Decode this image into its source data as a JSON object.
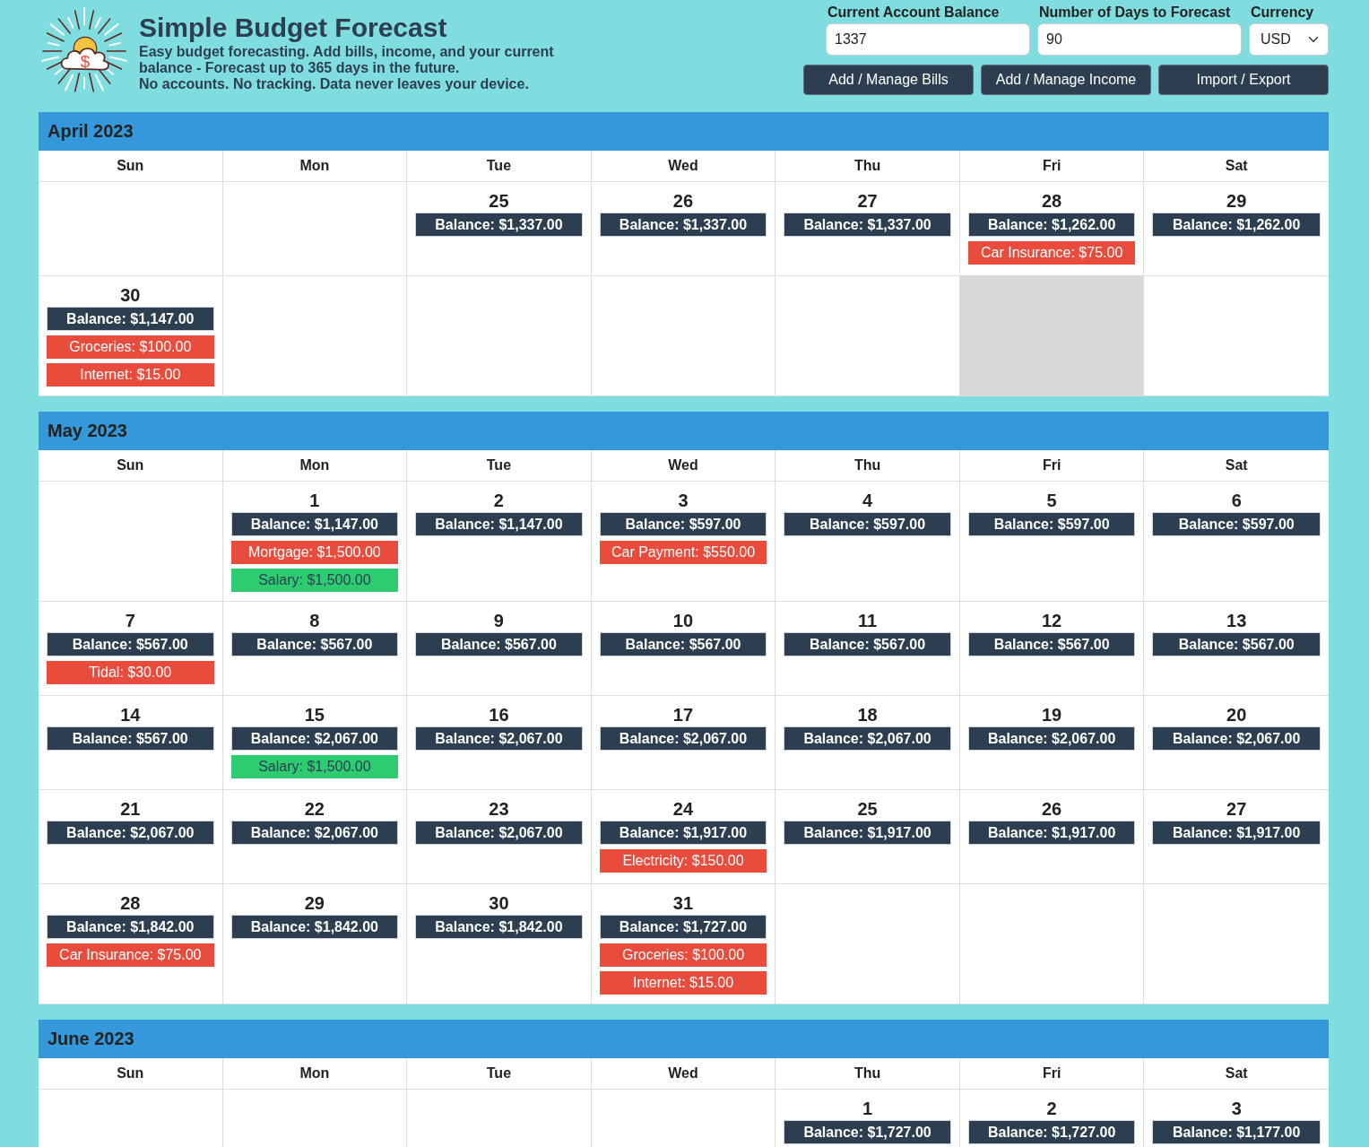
{
  "header": {
    "logo_symbol": "$",
    "title": "Simple Budget Forecast",
    "description": "Easy budget forecasting. Add bills, income, and your current balance - Forecast up to 365 days in the future.",
    "privacy_note": "No accounts. No tracking. Data never leaves your device."
  },
  "controls": {
    "fields": [
      {
        "kind": "text",
        "label": "Current Account Balance",
        "value": "1337"
      },
      {
        "kind": "text",
        "label": "Number of Days to Forecast",
        "value": "90"
      },
      {
        "kind": "select",
        "label": "Currency",
        "value": "USD"
      }
    ],
    "buttons": [
      "Add / Manage Bills",
      "Add / Manage Income",
      "Import / Export"
    ]
  },
  "months": [
    {
      "title": "April 2023",
      "weekdays": [
        "Sun",
        "Mon",
        "Tue",
        "Wed",
        "Thu",
        "Fri",
        "Sat"
      ],
      "weeks": [
        [
          {
            "highlighted": false
          },
          {
            "highlighted": false
          },
          {
            "day": "25",
            "balance": "Balance: $1,337.00",
            "highlighted": false
          },
          {
            "day": "26",
            "balance": "Balance: $1,337.00",
            "highlighted": false
          },
          {
            "day": "27",
            "balance": "Balance: $1,337.00",
            "highlighted": false
          },
          {
            "day": "28",
            "balance": "Balance: $1,262.00",
            "entries": [
              {
                "kind": "bill",
                "text": "Car Insurance: $75.00"
              }
            ],
            "highlighted": false
          },
          {
            "day": "29",
            "balance": "Balance: $1,262.00",
            "highlighted": false
          }
        ],
        [
          {
            "day": "30",
            "balance": "Balance: $1,147.00",
            "entries": [
              {
                "kind": "bill",
                "text": "Groceries: $100.00"
              },
              {
                "kind": "bill",
                "text": "Internet: $15.00"
              }
            ],
            "highlighted": false
          },
          {
            "highlighted": false
          },
          {
            "highlighted": false
          },
          {
            "highlighted": false
          },
          {
            "highlighted": false
          },
          {
            "highlighted": true
          },
          {
            "highlighted": false
          }
        ]
      ]
    },
    {
      "title": "May 2023",
      "weekdays": [
        "Sun",
        "Mon",
        "Tue",
        "Wed",
        "Thu",
        "Fri",
        "Sat"
      ],
      "weeks": [
        [
          {
            "highlighted": false
          },
          {
            "day": "1",
            "balance": "Balance: $1,147.00",
            "entries": [
              {
                "kind": "bill",
                "text": "Mortgage: $1,500.00"
              },
              {
                "kind": "income",
                "text": "Salary: $1,500.00"
              }
            ],
            "highlighted": false
          },
          {
            "day": "2",
            "balance": "Balance: $1,147.00",
            "highlighted": false
          },
          {
            "day": "3",
            "balance": "Balance: $597.00",
            "entries": [
              {
                "kind": "bill",
                "text": "Car Payment: $550.00"
              }
            ],
            "highlighted": false
          },
          {
            "day": "4",
            "balance": "Balance: $597.00",
            "highlighted": false
          },
          {
            "day": "5",
            "balance": "Balance: $597.00",
            "highlighted": false
          },
          {
            "day": "6",
            "balance": "Balance: $597.00",
            "highlighted": false
          }
        ],
        [
          {
            "day": "7",
            "balance": "Balance: $567.00",
            "entries": [
              {
                "kind": "bill",
                "text": "Tidal: $30.00"
              }
            ],
            "highlighted": false
          },
          {
            "day": "8",
            "balance": "Balance: $567.00",
            "highlighted": false
          },
          {
            "day": "9",
            "balance": "Balance: $567.00",
            "highlighted": false
          },
          {
            "day": "10",
            "balance": "Balance: $567.00",
            "highlighted": false
          },
          {
            "day": "11",
            "balance": "Balance: $567.00",
            "highlighted": false
          },
          {
            "day": "12",
            "balance": "Balance: $567.00",
            "highlighted": false
          },
          {
            "day": "13",
            "balance": "Balance: $567.00",
            "highlighted": false
          }
        ],
        [
          {
            "day": "14",
            "balance": "Balance: $567.00",
            "highlighted": false
          },
          {
            "day": "15",
            "balance": "Balance: $2,067.00",
            "entries": [
              {
                "kind": "income",
                "text": "Salary: $1,500.00"
              }
            ],
            "highlighted": false
          },
          {
            "day": "16",
            "balance": "Balance: $2,067.00",
            "highlighted": false
          },
          {
            "day": "17",
            "balance": "Balance: $2,067.00",
            "highlighted": false
          },
          {
            "day": "18",
            "balance": "Balance: $2,067.00",
            "highlighted": false
          },
          {
            "day": "19",
            "balance": "Balance: $2,067.00",
            "highlighted": false
          },
          {
            "day": "20",
            "balance": "Balance: $2,067.00",
            "highlighted": false
          }
        ],
        [
          {
            "day": "21",
            "balance": "Balance: $2,067.00",
            "highlighted": false
          },
          {
            "day": "22",
            "balance": "Balance: $2,067.00",
            "highlighted": false
          },
          {
            "day": "23",
            "balance": "Balance: $2,067.00",
            "highlighted": false
          },
          {
            "day": "24",
            "balance": "Balance: $1,917.00",
            "entries": [
              {
                "kind": "bill",
                "text": "Electricity: $150.00"
              }
            ],
            "highlighted": false
          },
          {
            "day": "25",
            "balance": "Balance: $1,917.00",
            "highlighted": false
          },
          {
            "day": "26",
            "balance": "Balance: $1,917.00",
            "highlighted": false
          },
          {
            "day": "27",
            "balance": "Balance: $1,917.00",
            "highlighted": false
          }
        ],
        [
          {
            "day": "28",
            "balance": "Balance: $1,842.00",
            "entries": [
              {
                "kind": "bill",
                "text": "Car Insurance: $75.00"
              }
            ],
            "highlighted": false
          },
          {
            "day": "29",
            "balance": "Balance: $1,842.00",
            "highlighted": false
          },
          {
            "day": "30",
            "balance": "Balance: $1,842.00",
            "highlighted": false
          },
          {
            "day": "31",
            "balance": "Balance: $1,727.00",
            "entries": [
              {
                "kind": "bill",
                "text": "Groceries: $100.00"
              },
              {
                "kind": "bill",
                "text": "Internet: $15.00"
              }
            ],
            "highlighted": false
          },
          {
            "highlighted": false
          },
          {
            "highlighted": false
          },
          {
            "highlighted": false
          }
        ]
      ]
    },
    {
      "title": "June 2023",
      "weekdays": [
        "Sun",
        "Mon",
        "Tue",
        "Wed",
        "Thu",
        "Fri",
        "Sat"
      ],
      "weeks": [
        [
          {
            "highlighted": false
          },
          {
            "highlighted": false
          },
          {
            "highlighted": false
          },
          {
            "highlighted": false
          },
          {
            "day": "1",
            "balance": "Balance: $1,727.00",
            "highlighted": false
          },
          {
            "day": "2",
            "balance": "Balance: $1,727.00",
            "highlighted": false
          },
          {
            "day": "3",
            "balance": "Balance: $1,177.00",
            "highlighted": false
          }
        ]
      ]
    }
  ]
}
